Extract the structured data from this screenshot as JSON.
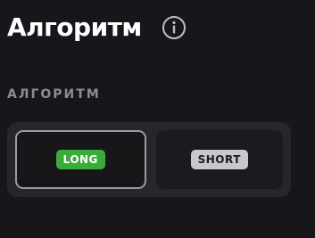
{
  "header": {
    "title": "Алгоритм",
    "info_icon": "info-circle-icon"
  },
  "section": {
    "label": "АЛГОРИТМ"
  },
  "segments": [
    {
      "label": "LONG",
      "selected": true,
      "color": "#3bab3c"
    },
    {
      "label": "SHORT",
      "selected": false,
      "color": "#c8c8cc"
    }
  ]
}
